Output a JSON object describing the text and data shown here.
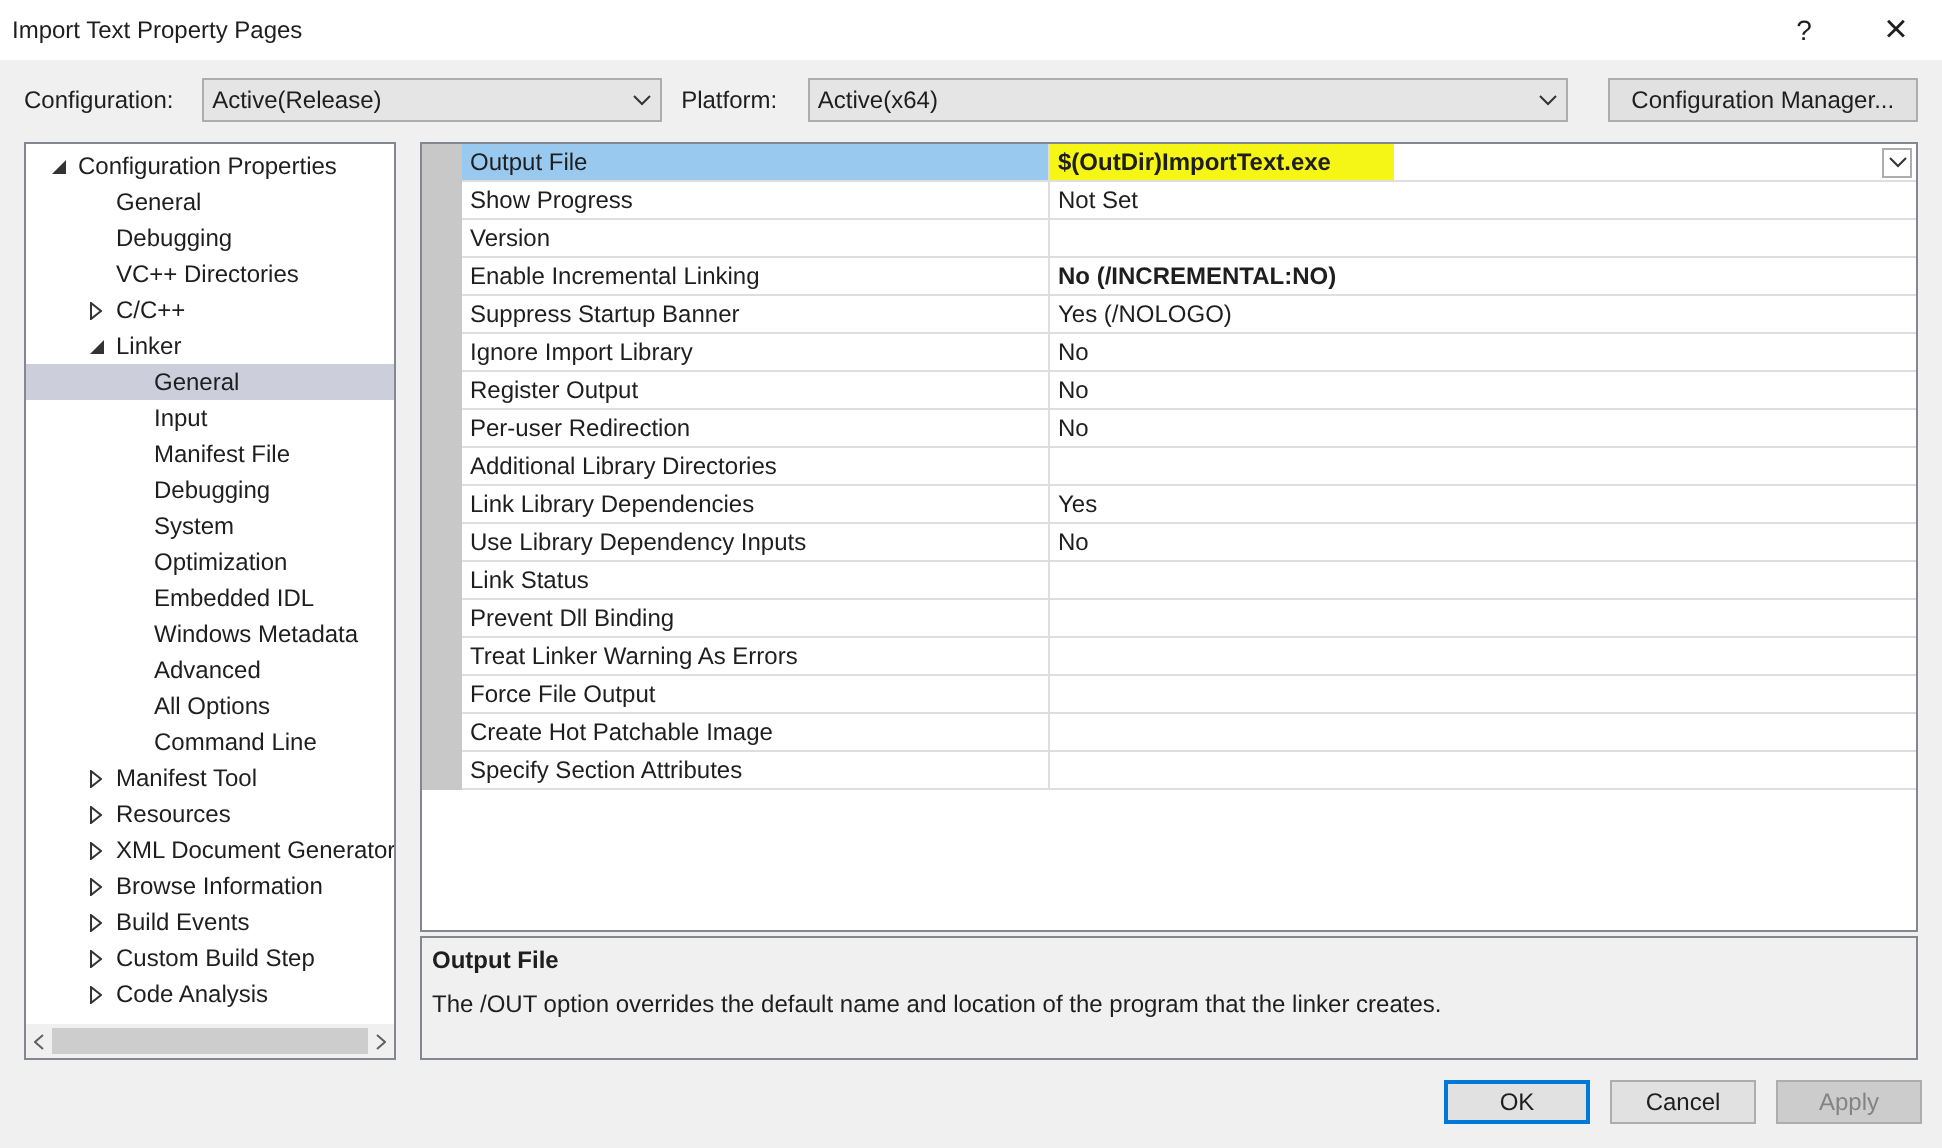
{
  "window": {
    "title": "Import Text Property Pages",
    "help": "?",
    "close": "×"
  },
  "configuration": {
    "label": "Configuration:",
    "value": "Active(Release)"
  },
  "platform": {
    "label": "Platform:",
    "value": "Active(x64)"
  },
  "config_manager_button": "Configuration Manager...",
  "tree": [
    {
      "label": "Configuration Properties",
      "expanded": true,
      "selected": false,
      "children": [
        {
          "label": "General",
          "selected": false
        },
        {
          "label": "Debugging",
          "selected": false
        },
        {
          "label": "VC++ Directories",
          "selected": false
        },
        {
          "label": "C/C++",
          "expanded": false,
          "selected": false
        },
        {
          "label": "Linker",
          "expanded": true,
          "selected": false,
          "children": [
            {
              "label": "General",
              "selected": true
            },
            {
              "label": "Input",
              "selected": false
            },
            {
              "label": "Manifest File",
              "selected": false
            },
            {
              "label": "Debugging",
              "selected": false
            },
            {
              "label": "System",
              "selected": false
            },
            {
              "label": "Optimization",
              "selected": false
            },
            {
              "label": "Embedded IDL",
              "selected": false
            },
            {
              "label": "Windows Metadata",
              "selected": false
            },
            {
              "label": "Advanced",
              "selected": false
            },
            {
              "label": "All Options",
              "selected": false
            },
            {
              "label": "Command Line",
              "selected": false
            }
          ]
        },
        {
          "label": "Manifest Tool",
          "expanded": false,
          "selected": false
        },
        {
          "label": "Resources",
          "expanded": false,
          "selected": false
        },
        {
          "label": "XML Document Generator",
          "expanded": false,
          "selected": false
        },
        {
          "label": "Browse Information",
          "expanded": false,
          "selected": false
        },
        {
          "label": "Build Events",
          "expanded": false,
          "selected": false
        },
        {
          "label": "Custom Build Step",
          "expanded": false,
          "selected": false
        },
        {
          "label": "Code Analysis",
          "expanded": false,
          "selected": false
        }
      ]
    }
  ],
  "properties": [
    {
      "name": "Output File",
      "value": "$(OutDir)ImportText.exe",
      "bold": true,
      "selected": true,
      "highlighted": true
    },
    {
      "name": "Show Progress",
      "value": "Not Set",
      "bold": false,
      "selected": false,
      "highlighted": false
    },
    {
      "name": "Version",
      "selected": false
    },
    {
      "name": "Enable Incremental Linking",
      "value": "No (/INCREMENTAL:NO)",
      "bold": true,
      "selected": false,
      "highlighted": false
    },
    {
      "name": "Suppress Startup Banner",
      "value": "Yes (/NOLOGO)",
      "bold": false,
      "selected": false,
      "highlighted": false
    },
    {
      "name": "Ignore Import Library",
      "value": "No",
      "bold": false,
      "selected": false,
      "highlighted": false
    },
    {
      "name": "Register Output",
      "value": "No",
      "bold": false,
      "selected": false,
      "highlighted": false
    },
    {
      "name": "Per-user Redirection",
      "value": "No",
      "bold": false,
      "selected": false,
      "highlighted": false
    },
    {
      "name": "Additional Library Directories",
      "selected": false
    },
    {
      "name": "Link Library Dependencies",
      "value": "Yes",
      "bold": false,
      "selected": false,
      "highlighted": false
    },
    {
      "name": "Use Library Dependency Inputs",
      "value": "No",
      "bold": false,
      "selected": false,
      "highlighted": false
    },
    {
      "name": "Link Status",
      "selected": false
    },
    {
      "name": "Prevent Dll Binding",
      "selected": false
    },
    {
      "name": "Treat Linker Warning As Errors",
      "selected": false
    },
    {
      "name": "Force File Output",
      "selected": false
    },
    {
      "name": "Create Hot Patchable Image",
      "selected": false
    },
    {
      "name": "Specify Section Attributes",
      "selected": false
    }
  ],
  "description": {
    "title": "Output File",
    "text": "The /OUT option overrides the default name and location of the program that the linker creates."
  },
  "buttons": [
    {
      "label": "OK",
      "kind": "default",
      "disabled": false
    },
    {
      "label": "Cancel",
      "kind": "normal",
      "disabled": false
    },
    {
      "label": "Apply",
      "kind": "normal",
      "disabled": true
    }
  ]
}
